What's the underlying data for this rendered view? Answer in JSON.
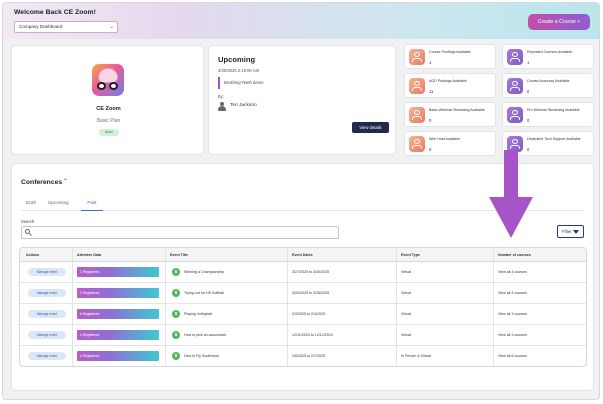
{
  "header": {
    "welcome": "Welcome Back CE Zoom!",
    "dashboard_select": "Company Dashboard",
    "create_course_label": "Create a Course +"
  },
  "profile": {
    "name": "CE Zoom",
    "plan": "Basic Plan",
    "status_badge": "Basic"
  },
  "upcoming": {
    "title": "Upcoming",
    "datetime": "4/30/2025 2:19:00 AM",
    "event_name": "Brushing Teeth demo",
    "by_label": "By:",
    "presenter": "Teri Jackson",
    "view_details_label": "View details"
  },
  "stats": [
    {
      "label": "Course Postings Available",
      "value": "1",
      "color": "orange"
    },
    {
      "label": "Repeated Courses Available",
      "value": "1",
      "color": "purple"
    },
    {
      "label": "AGD Postings Available",
      "value": "11",
      "color": "orange"
    },
    {
      "label": "Course Accuracy Available",
      "value": "0",
      "color": "purple"
    },
    {
      "label": "Basic Webinar Streaming Available",
      "value": "0",
      "color": "orange"
    },
    {
      "label": "Pro Webinar Streaming Available",
      "value": "0",
      "color": "purple"
    },
    {
      "label": "Web Host Available",
      "value": "0",
      "color": "orange"
    },
    {
      "label": "Dedicated Tech Support Available",
      "value": "0",
      "color": "purple"
    }
  ],
  "conferences": {
    "title": "Conferences",
    "tabs": [
      "Draft",
      "Upcoming",
      "Past"
    ],
    "active_tab": "Past",
    "search_label": "Search",
    "filter_label": "Filter",
    "columns": [
      "Actions",
      "Attendee Data",
      "Event Title",
      "Event Dates",
      "Event Type",
      "Number of courses"
    ],
    "rows": [
      {
        "action": "Manage event",
        "attendees": "1 Registered",
        "title": "Winning a Championship",
        "dates": "3/27/2025 to 3/30/2025",
        "type": "Virtual",
        "courses": "View all 4 courses"
      },
      {
        "action": "Manage event",
        "attendees": "2 Registered",
        "title": "Trying out for HS Softball",
        "dates": "3/20/2025 to 3/26/2025",
        "type": "Virtual",
        "courses": "View all 4 courses"
      },
      {
        "action": "Manage event",
        "attendees": "6 Registered",
        "title": "Playing Volleyball",
        "dates": "2/3/2025 to 2/4/2025",
        "type": "Virtual",
        "courses": "View all 3 courses"
      },
      {
        "action": "Manage event",
        "attendees": "4 Registered",
        "title": "How to pick an accountant",
        "dates": "12/11/2024 to 12/12/2024",
        "type": "Virtual",
        "courses": "View all 3 courses"
      },
      {
        "action": "Manage event",
        "attendees": "4 Registered",
        "title": "How to Fly Southwest",
        "dates": "2/6/2025 to 2/7/2025",
        "type": "In Person & Virtual",
        "courses": "View all 6 courses"
      }
    ]
  },
  "colors": {
    "accent_purple": "#a555c7",
    "navy": "#1f2a4d",
    "tab_blue": "#3d6fd6"
  }
}
